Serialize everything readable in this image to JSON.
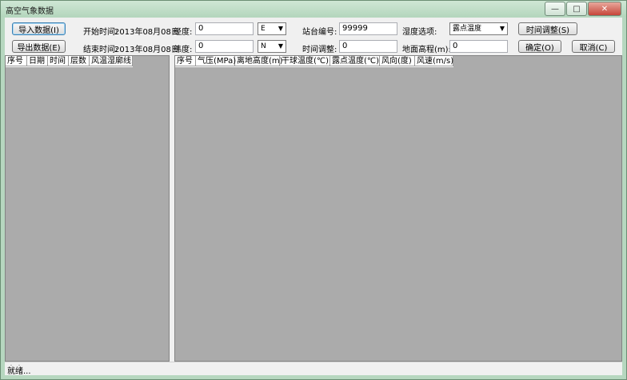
{
  "window": {
    "title": "高空气象数据"
  },
  "toolbar": {
    "import_label": "导入数据(I)",
    "export_label": "导出数据(E)",
    "start_time_label": "开始时间:",
    "start_time_value": "2013年08月08日",
    "end_time_label": "结束时间:",
    "end_time_value": "2013年08月08日",
    "longitude_label": "经度:",
    "longitude_value": "0",
    "longitude_dir": "E",
    "latitude_label": "纬度:",
    "latitude_value": "0",
    "latitude_dir": "N",
    "station_label": "站台编号:",
    "station_value": "99999",
    "time_adjust_label": "时间调整:",
    "time_adjust_value": "0",
    "humidity_label": "湿度选项:",
    "humidity_value": "露点温度",
    "ground_elev_label": "地面高程(m):",
    "ground_elev_value": "0",
    "time_adjust_btn": "时间调整(S)",
    "ok_btn": "确定(O)",
    "cancel_btn": "取消(C)"
  },
  "left_grid": {
    "columns": [
      "序号",
      "日期",
      "时间",
      "层数",
      "风温湿廓线"
    ]
  },
  "right_grid": {
    "columns": [
      "序号",
      "气压(MPa)",
      "离地高度(m)",
      "干球温度(℃)",
      "露点温度(℃)",
      "风向(度)",
      "风速(m/s)"
    ]
  },
  "status": {
    "text": "就绪..."
  }
}
